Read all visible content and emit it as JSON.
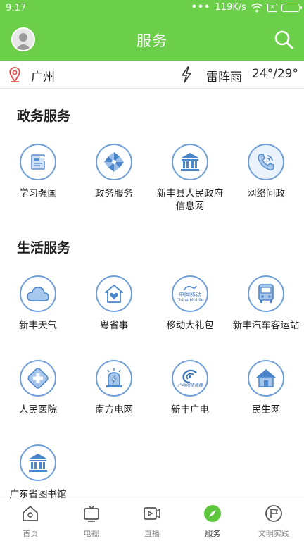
{
  "status": {
    "time": "9:17",
    "dots": "•••",
    "speed": "119K/s",
    "sim": "x"
  },
  "header": {
    "title": "服务"
  },
  "weather": {
    "city": "广州",
    "condition": "雷阵雨",
    "temp": "24°/29°"
  },
  "sections": [
    {
      "title": "政务服务",
      "items": [
        {
          "label": "学习强国",
          "icon": "study-icon"
        },
        {
          "label": "政务服务",
          "icon": "pinwheel-icon"
        },
        {
          "label": "新丰县人民政府信息网",
          "icon": "government-building-icon"
        },
        {
          "label": "网络问政",
          "icon": "phone-icon"
        }
      ]
    },
    {
      "title": "生活服务",
      "items": [
        {
          "label": "新丰天气",
          "icon": "cloud-icon"
        },
        {
          "label": "粤省事",
          "icon": "heart-house-icon"
        },
        {
          "label": "移动大礼包",
          "icon": "china-mobile-icon"
        },
        {
          "label": "新丰汽车客运站",
          "icon": "bus-icon"
        },
        {
          "label": "人民医院",
          "icon": "hospital-cross-icon"
        },
        {
          "label": "南方电网",
          "icon": "power-grid-icon"
        },
        {
          "label": "新丰广电",
          "icon": "broadcast-icon"
        },
        {
          "label": "民生网",
          "icon": "house-icon"
        },
        {
          "label": "广东省图书馆",
          "icon": "library-icon"
        }
      ]
    }
  ],
  "mobile_logo": {
    "cn": "中国移动",
    "en": "China Mobile"
  },
  "broadcast_logo": {
    "text": "广电网络传媒"
  },
  "nav": [
    {
      "label": "首页",
      "icon": "home-icon"
    },
    {
      "label": "电视",
      "icon": "tv-icon"
    },
    {
      "label": "直播",
      "icon": "live-video-icon"
    },
    {
      "label": "服务",
      "icon": "compass-icon",
      "active": true
    },
    {
      "label": "文明实践",
      "icon": "flag-circle-icon"
    }
  ],
  "colors": {
    "brand": "#6ccf4a",
    "icon_stroke": "#6f9fd8"
  }
}
